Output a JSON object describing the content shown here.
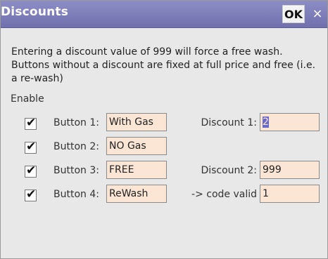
{
  "window": {
    "title": "Discounts",
    "ok_label": "OK",
    "close_glyph": "×"
  },
  "description": "Entering a discount value of 999 will force a free wash. Buttons without a discount are fixed at full price and free (i.e. a re-wash)",
  "enable_label": "Enable",
  "buttons": [
    {
      "label": "Button 1:",
      "value": "With Gas",
      "enabled": true,
      "check_glyph": "✔"
    },
    {
      "label": "Button 2:",
      "value": "NO Gas",
      "enabled": true,
      "check_glyph": "✔"
    },
    {
      "label": "Button 3:",
      "value": "FREE",
      "enabled": true,
      "check_glyph": "✔"
    },
    {
      "label": "Button 4:",
      "value": "ReWash",
      "enabled": true,
      "check_glyph": "✔"
    }
  ],
  "discounts": [
    {
      "label": "Discount 1:",
      "value": "2"
    },
    {
      "label": "Discount 2:",
      "value": "999"
    },
    {
      "label": "-> code valid",
      "value": "1"
    }
  ]
}
